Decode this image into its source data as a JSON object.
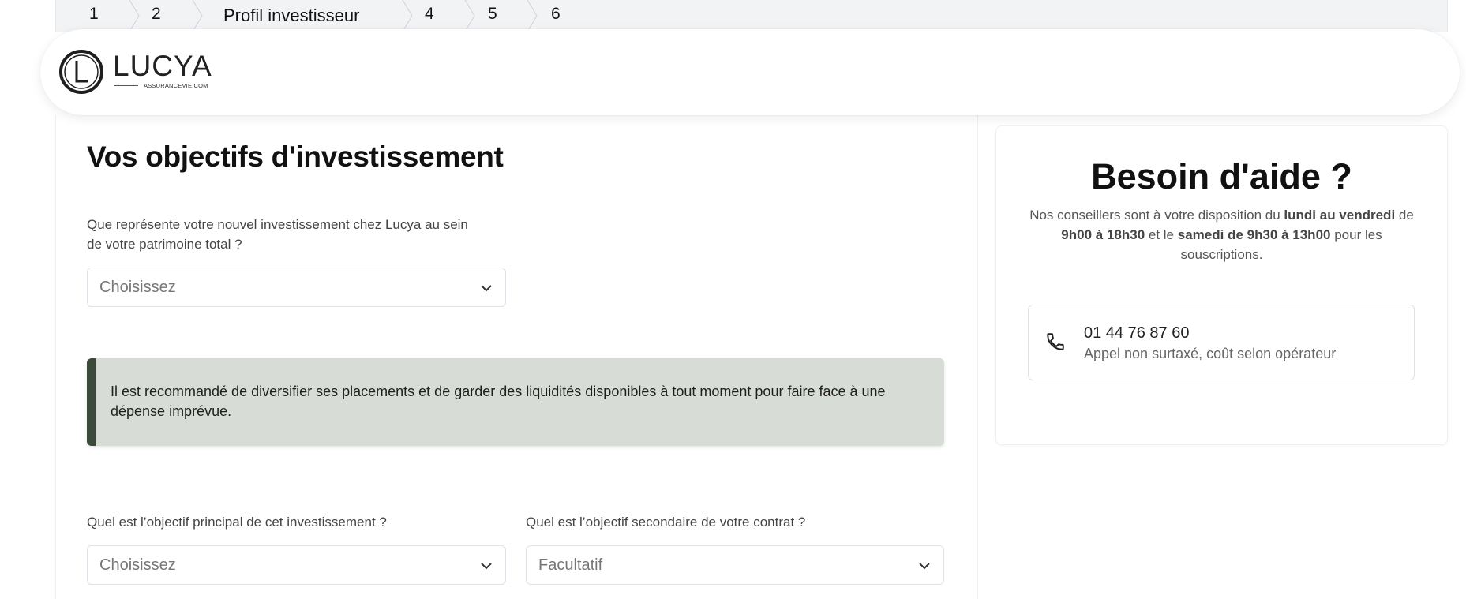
{
  "stepper": {
    "steps": [
      "1",
      "2",
      "Profil investisseur",
      "4",
      "5",
      "6"
    ]
  },
  "brand": {
    "logo_text": "LUCYA",
    "logo_sub": "ASSURANCEVIE.COM"
  },
  "main": {
    "title": "Vos objectifs d'investissement",
    "q1": {
      "label_line1": "Que représente votre nouvel investissement chez Lucya au sein",
      "label_line2": "de votre patrimoine total ?",
      "placeholder": "Choisissez"
    },
    "info_text": "Il est recommandé de diversifier ses placements et de garder des liquidités disponibles à tout moment pour faire face à une dépense imprévue.",
    "q2": {
      "label": "Quel est l’objectif principal de cet investissement ?",
      "placeholder": "Choisissez"
    },
    "q3": {
      "label": "Quel est l’objectif secondaire de votre contrat ?",
      "placeholder": "Facultatif"
    }
  },
  "help": {
    "title": "Besoin d'aide ?",
    "desc_1": "Nos conseillers sont à votre disposition du ",
    "desc_days": "lundi au vendredi",
    "desc_2": " de ",
    "desc_hours": "9h00 à 18h30",
    "desc_3": " et le ",
    "desc_sat": "samedi de 9h30 à 13h00",
    "desc_4": " pour les souscriptions.",
    "phone": "01 44 76 87 60",
    "phone_note": "Appel non surtaxé, coût selon opérateur"
  },
  "icons": [
    "chevron-down-icon",
    "phone-icon",
    "logo-mark-icon"
  ],
  "colors": {
    "info_bg": "#d8dcd6",
    "info_accent": "#3c4a3c",
    "stepper_bg": "#f2f3f5"
  }
}
